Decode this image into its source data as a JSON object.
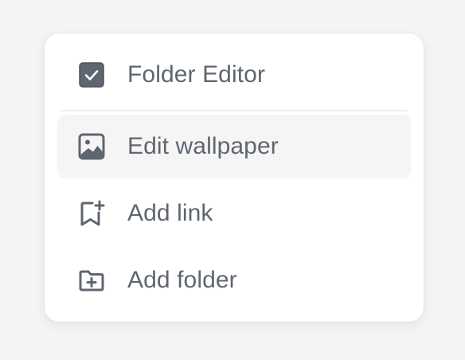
{
  "menu": {
    "folder_editor": {
      "label": "Folder Editor",
      "checked": true,
      "icon": "checkbox-checked-icon"
    },
    "edit_wallpaper": {
      "label": "Edit wallpaper",
      "icon": "image-icon",
      "hovered": true
    },
    "add_link": {
      "label": "Add link",
      "icon": "bookmark-plus-icon"
    },
    "add_folder": {
      "label": "Add folder",
      "icon": "folder-plus-icon"
    }
  },
  "colors": {
    "background": "#f4f4f4",
    "menu_background": "#ffffff",
    "text": "#5f6670",
    "icon": "#5f6670",
    "hover_background": "#f5f5f5",
    "checkbox_fill": "#5f6670"
  }
}
